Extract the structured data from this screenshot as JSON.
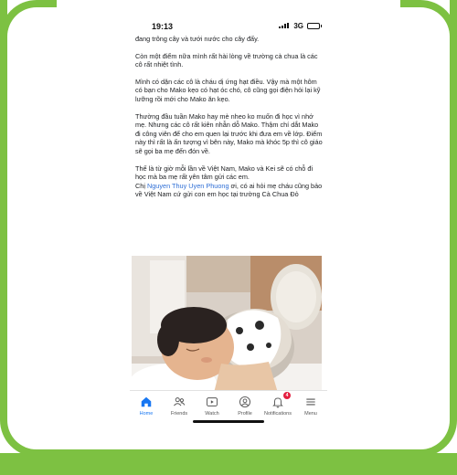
{
  "status_bar": {
    "time": "19:13",
    "network": "3G"
  },
  "post": {
    "paragraphs": [
      "đang trông cây và tưới nước cho cây đấy.",
      "Còn một điểm nữa mình rất hài lòng về trường cà chua là các cô rất nhiệt tình.",
      "Mình có dặn các cô là cháu dị ứng hạt điều. Vậy mà một hôm có bạn cho Mako kẹo có hạt óc chó, cô cũng gọi điện hỏi lại kỹ lưỡng rồi mới cho Mako ăn kẹo.",
      "Thường đầu tuần Mako hay mè nheo ko muốn đi học vì nhớ mẹ. Nhưng các cô rất kiên nhẫn dỗ Mako. Thậm chí dắt Mako đi công viên để cho em quen lại trước khi đưa em về lớp. Điểm này thì rất là ấn tượng vì bên này, Mako mà khóc 5p thì cô giáo sẽ gọi ba mẹ đến đón về.",
      "Thế là từ giờ mỗi lần về Việt Nam, Mako và Kei sẽ có chỗ đi học mà ba mẹ rất yên tâm gửi các em."
    ],
    "closing_prefix": "Chị ",
    "mention": "Nguyen Thuy Uyen Phuong",
    "closing_suffix": " ơi, có ai hỏi mẹ cháu cũng bảo về Việt Nam cứ gửi con em học tại trường Cà Chua Đỏ"
  },
  "tab_bar": {
    "tabs": [
      {
        "label": "Home",
        "icon": "home-icon",
        "active": true
      },
      {
        "label": "Friends",
        "icon": "friends-icon",
        "active": false
      },
      {
        "label": "Watch",
        "icon": "watch-icon",
        "active": false
      },
      {
        "label": "Profile",
        "icon": "profile-icon",
        "active": false
      },
      {
        "label": "Notifications",
        "icon": "bell-icon",
        "active": false,
        "badge": "4"
      },
      {
        "label": "Menu",
        "icon": "menu-icon",
        "active": false
      }
    ]
  },
  "colors": {
    "frame_green": "#7dc142",
    "active_blue": "#1877f2",
    "badge_red": "#e41e3f",
    "mention_blue": "#2f6fd6"
  }
}
